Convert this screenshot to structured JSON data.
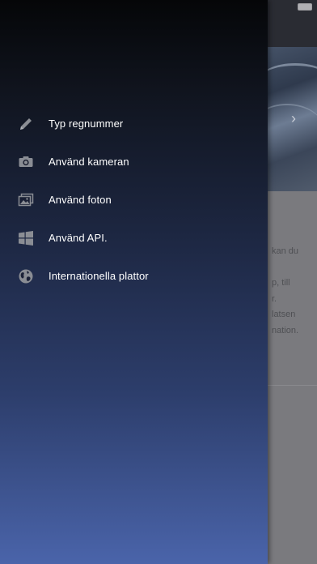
{
  "colors": {
    "drawer_gradient_top": "#050608",
    "drawer_gradient_bottom": "#4a64aa",
    "menu_text": "#ffffff",
    "menu_icon": "#8a8d94"
  },
  "menu": {
    "items": [
      {
        "label": "Typ regnummer",
        "icon": "pencil-icon"
      },
      {
        "label": "Använd kameran",
        "icon": "camera-icon"
      },
      {
        "label": "Använd foton",
        "icon": "photos-icon"
      },
      {
        "label": "Använd API.",
        "icon": "windows-icon"
      },
      {
        "label": "Internationella plattor",
        "icon": "globe-icon"
      }
    ]
  },
  "background": {
    "text_lines": [
      "kan du",
      "",
      "p, till",
      "r.",
      "latsen",
      "nation."
    ]
  }
}
